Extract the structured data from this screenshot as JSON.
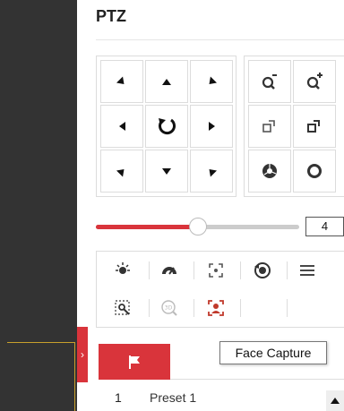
{
  "ptz": {
    "title": "PTZ",
    "speed": {
      "value": "4",
      "fraction": 0.5
    },
    "tooltip": "Face Capture"
  },
  "icons": {
    "directions": [
      "up-left-arrow-icon",
      "up-arrow-icon",
      "up-right-arrow-icon",
      "left-arrow-icon",
      "auto-rotate-icon",
      "right-arrow-icon",
      "down-left-arrow-icon",
      "down-arrow-icon",
      "down-right-arrow-icon"
    ],
    "lens": [
      "zoom-out-icon",
      "zoom-in-icon",
      "focus-near-icon",
      "focus-far-icon",
      "iris-close-icon",
      "iris-open-icon"
    ],
    "functions": [
      "light-icon",
      "wiper-icon",
      "manual-tracking-icon",
      "one-touch-park-icon",
      "menu-icon",
      "zoom-area-icon",
      "3d-zoom-icon",
      "face-capture-icon"
    ]
  },
  "preset_list": [
    {
      "number": "1",
      "name": "Preset 1"
    }
  ],
  "colors": {
    "accent": "#d9343b",
    "sidebar": "#333333"
  }
}
